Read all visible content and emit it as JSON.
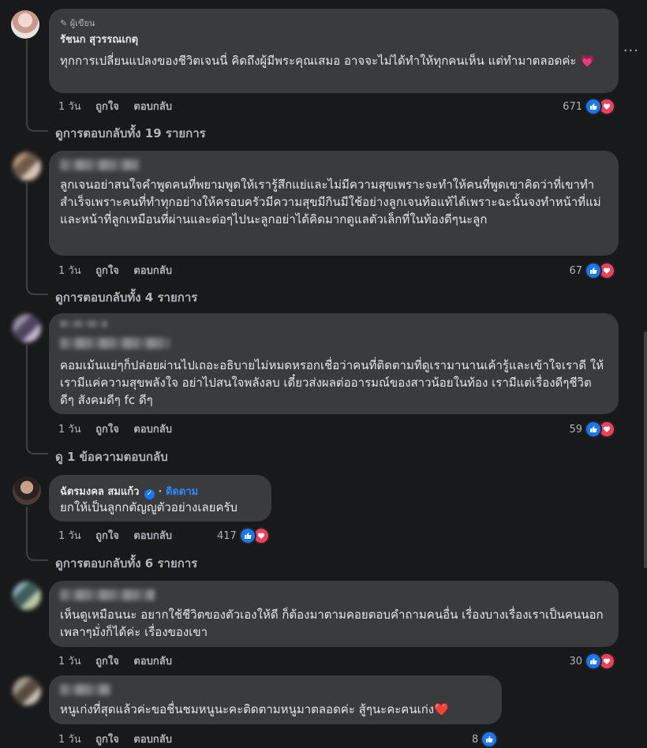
{
  "labels": {
    "like": "ถูกใจ",
    "reply": "ตอบกลับ"
  },
  "comments": [
    {
      "author_badge": "ผู้เขียน",
      "author": "รัชนก สุวรรณเกตุ",
      "text": "ทุกการเปลี่ยนแปลงของชีวิตเจนนี่ คิดถึงผู้มีพระคุณเสมอ อาจจะไม่ได้ทำให้ทุกคนเห็น แต่ทำมาตลอดค่ะ 💗",
      "time": "1 วัน",
      "reactions": "671",
      "view_replies": "ดูการตอบกลับทั้ง 19 รายการ"
    },
    {
      "text": "ลูกเจนอย่าสนใจคำพูดคนที่พยามพูดให้เรารู้สึกแย่และไม่มีความสุขเพราะจะทำให้คนที่พูดเขาคิดว่าที่เขาทำสำเร็จเพราะคนที่ทำทุกอย่างให้ครอบครัวมีความสุขมีกินมีใช้อย่างลูกเจนท้อแท้ได้เพราะฉะนั้นจงทำหน้าที่แม่และหน้าที่ลูกเหมือนที่ผ่านและต่อๆไปนะลูกอย่าได้คิดมากดูแลตัวเล็กที่ในท้องดีๆนะลูก",
      "time": "1 วัน",
      "reactions": "67",
      "view_replies": "ดูการตอบกลับทั้ง 4 รายการ"
    },
    {
      "text": "คอมเม้นแย่ๆก็ปล่อยผ่านไปเถอะอธิบายไม่หมดหรอกเชื่อว่าคนที่ติดตามที่ดูเรามานานเค้ารู้และเข้าใจเราดี ให้เรามีแค่ความสุขพลังใจ อย่าไปสนใจพลังลบ เดี๋ยวส่งผลต่ออารมณ์ของสาวน้อยในท้อง เรามีแต่เรื่องดีๆชีวิตดีๆ สังคมดีๆ fc ดีๆ",
      "time": "1 วัน",
      "reactions": "59",
      "view_replies": "ดู 1 ข้อความตอบกลับ"
    },
    {
      "author": "ฉัตรมงคล สมแก้ว",
      "follow": "ติดตาม",
      "text": "ยกให้เป็นลูกกตัญญูตัวอย่างเลยครับ",
      "time": "1 วัน",
      "reactions": "417",
      "view_replies": "ดูการตอบกลับทั้ง 6 รายการ"
    },
    {
      "text": "เห็นดูเหมือนนะ อยากใช้ชีวิตของตัวเองให้ดี ก็ต้องมาตามคอยตอบคำถามคนอื่น เรื่องบางเรื่องเราเป็นคนนอก เพลาๆมั่งก็ได้ค่ะ เรื่องของเขา",
      "time": "1 วัน",
      "reactions": "30"
    },
    {
      "text": "หนูเก่งที่สุดแล้วค่ะขอชื่นชมหนูนะคะติดตามหนูมาตลอดค่ะ สู้ๆนะคะคนเก่ง❤️",
      "time": "1 วัน",
      "reactions": "8"
    }
  ]
}
